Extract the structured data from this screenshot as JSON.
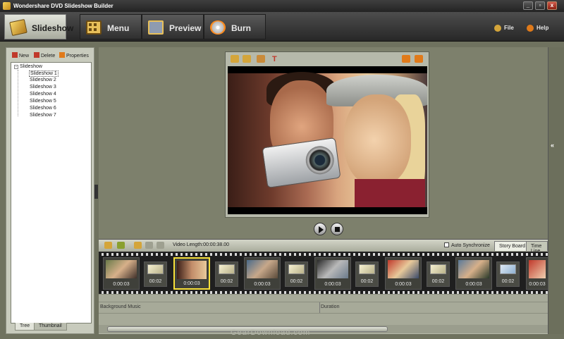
{
  "window": {
    "title": "Wondershare DVD Slideshow Builder",
    "controls": [
      "_",
      "▫",
      "x"
    ]
  },
  "tabs": [
    {
      "label": "Slideshow",
      "icon": "slideshow-icon",
      "active": true
    },
    {
      "label": "Menu",
      "icon": "menu-icon",
      "active": false
    },
    {
      "label": "Preview",
      "icon": "preview-icon",
      "active": false
    },
    {
      "label": "Burn",
      "icon": "burn-icon",
      "active": false
    }
  ],
  "topright": {
    "file_label": "File",
    "help_label": "Help"
  },
  "left": {
    "toolbar": {
      "new_label": "New",
      "delete_label": "Delete",
      "properties_label": "Properties"
    },
    "tree": {
      "root": "Slideshow",
      "items": [
        "Slideshow 1",
        "Slideshow 2",
        "Slideshow 3",
        "Slideshow 4",
        "Slideshow 5",
        "Slideshow 6",
        "Slideshow 7"
      ]
    },
    "bottom_tabs": [
      "Tree",
      "Thumbnail"
    ]
  },
  "storyboard": {
    "video_length": "Video Length:00:00:38.00",
    "auto_sync_label": "Auto Synchronize",
    "tabs": [
      "Story Board",
      "Time Line"
    ],
    "clips": [
      {
        "kind": "slide",
        "duration": "0:00:03"
      },
      {
        "kind": "trans",
        "duration": "00:02"
      },
      {
        "kind": "slide",
        "duration": "0:00:03",
        "selected": true
      },
      {
        "kind": "trans",
        "duration": "00:02"
      },
      {
        "kind": "slide",
        "duration": "0:00:03"
      },
      {
        "kind": "trans",
        "duration": "00:02"
      },
      {
        "kind": "slide",
        "duration": "0:00:03"
      },
      {
        "kind": "trans",
        "duration": "00:02"
      },
      {
        "kind": "slide",
        "duration": "0:00:03"
      },
      {
        "kind": "trans",
        "duration": "00:02"
      },
      {
        "kind": "slide",
        "duration": "0:00:03"
      },
      {
        "kind": "trans",
        "duration": "00:02"
      },
      {
        "kind": "slide",
        "duration": "0:00:03"
      }
    ],
    "music_track": {
      "background_music": "Background Music",
      "duration": "Duration"
    }
  },
  "watermark": "GearDownload.com",
  "colors": {
    "accent_selected": "#f7e03a",
    "panel": "#b6b9aa",
    "titlebar": "#2b2b2b"
  }
}
